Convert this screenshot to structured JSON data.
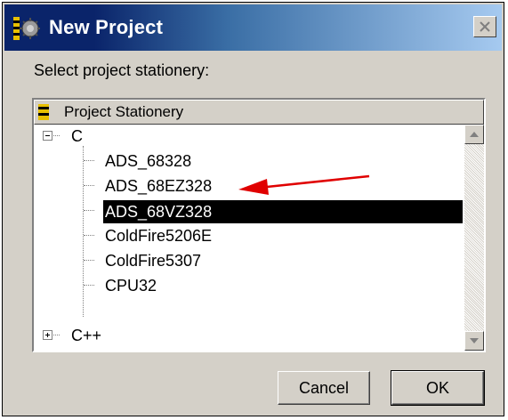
{
  "window": {
    "title": "New Project",
    "title_icon": "project-wizard-icon",
    "close_icon": "close-icon"
  },
  "prompt": "Select project stationery:",
  "tree": {
    "header": "Project Stationery",
    "header_icon": "stationery-icon",
    "items": [
      {
        "label": "C",
        "type": "folder",
        "expanded": true
      },
      {
        "label": "ADS_68328",
        "type": "leaf"
      },
      {
        "label": "ADS_68EZ328",
        "type": "leaf"
      },
      {
        "label": "ADS_68VZ328",
        "type": "leaf",
        "selected": true
      },
      {
        "label": "ColdFire5206E",
        "type": "leaf"
      },
      {
        "label": "ColdFire5307",
        "type": "leaf"
      },
      {
        "label": "CPU32",
        "type": "leaf"
      },
      {
        "label": "C++",
        "type": "folder",
        "expanded": false
      }
    ]
  },
  "scrollbar": {
    "up_icon": "scroll-up-arrow-icon",
    "down_icon": "scroll-down-arrow-icon"
  },
  "buttons": {
    "cancel": "Cancel",
    "ok": "OK"
  },
  "annotation": {
    "icon": "red-arrow-icon",
    "color": "#e00000"
  },
  "colors": {
    "title_bar_start": "#0a246a",
    "title_bar_end": "#a6caf0",
    "dialog_face": "#d4d0c8",
    "selection": "#000000"
  }
}
